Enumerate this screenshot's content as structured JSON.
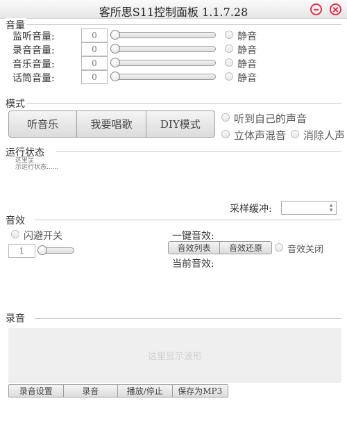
{
  "window": {
    "title": "客所思S11控制面板 1.1.7.28",
    "minimize_icon": "minus-circle-icon",
    "close_icon": "x-circle-icon",
    "accent_color": "#e0304a"
  },
  "volume": {
    "section_title": "音量",
    "rows": [
      {
        "label": "监听音量:",
        "value": "0",
        "level": 0,
        "mute_label": "静音"
      },
      {
        "label": "录音音量:",
        "value": "0",
        "level": 0,
        "mute_label": "静音"
      },
      {
        "label": "音乐音量:",
        "value": "0",
        "level": 0,
        "mute_label": "静音"
      },
      {
        "label": "话筒音量:",
        "value": "0",
        "level": 0,
        "mute_label": "静音"
      }
    ]
  },
  "mode": {
    "section_title": "模式",
    "buttons": [
      "听音乐",
      "我要唱歌",
      "DIY模式"
    ],
    "options": {
      "hear_self": "听到自己的声音",
      "stereo_mix": "立体声混音",
      "remove_vocals": "消除人声"
    }
  },
  "status": {
    "section_title": "运行状态",
    "text_line1": "这里显",
    "text_line2": "示运行状态......"
  },
  "sample_buffer": {
    "label": "采样缓冲:",
    "value": ""
  },
  "effects": {
    "section_title": "音效",
    "dodge_toggle": "闪避开关",
    "dodge_value": "1",
    "dodge_level": 0,
    "one_key_label": "一键音效:",
    "list_button": "音效列表",
    "restore_button": "音效还原",
    "off_label": "音效关闭",
    "current_label": "当前音效:"
  },
  "recording": {
    "section_title": "录音",
    "waveform_placeholder": "这里显示波形",
    "buttons": [
      "录音设置",
      "录音",
      "播放/停止",
      "保存为MP3"
    ]
  }
}
